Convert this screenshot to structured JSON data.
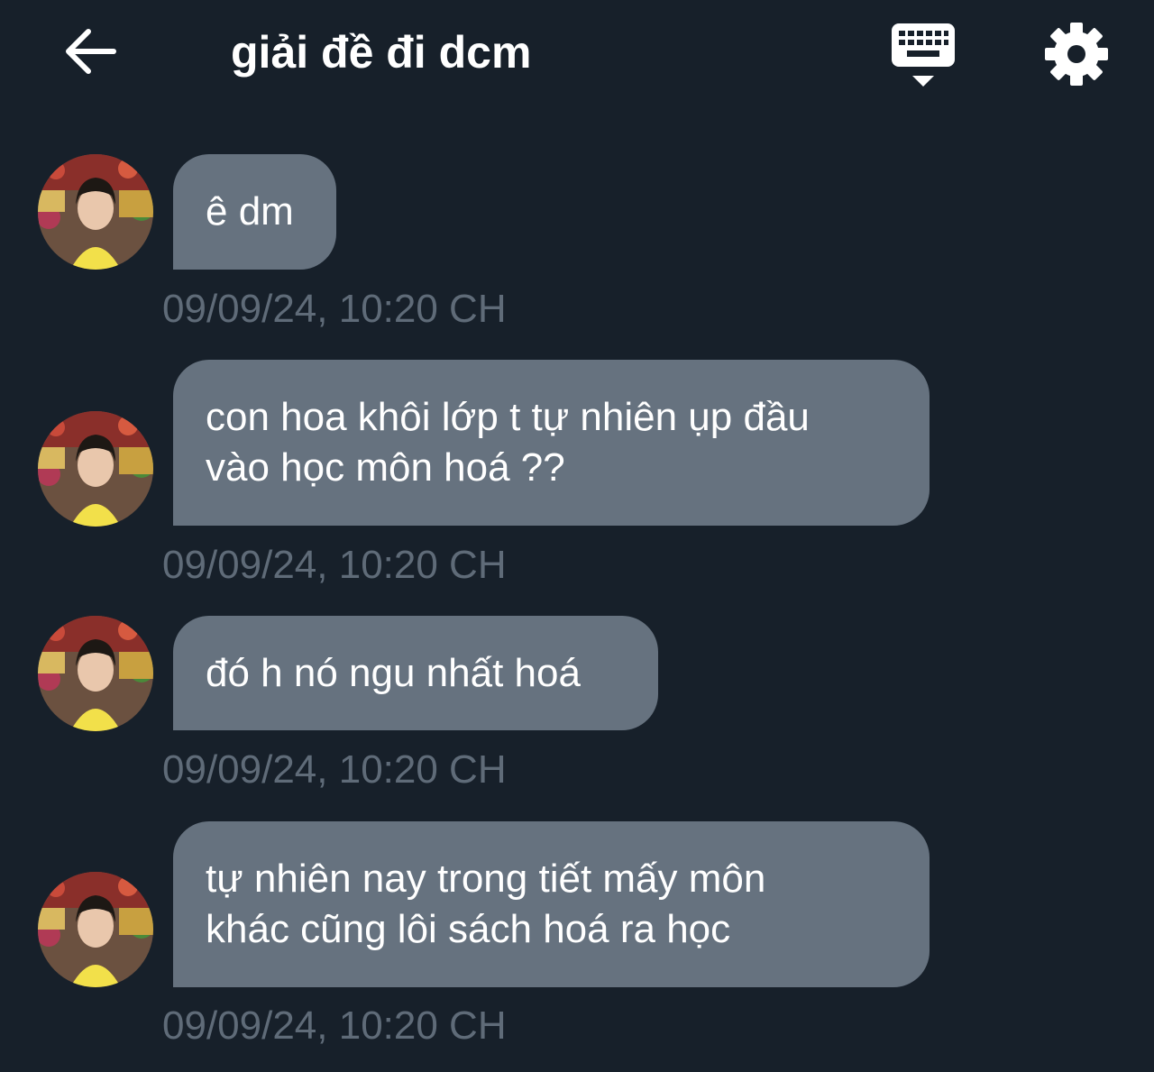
{
  "header": {
    "back_icon": "arrow-left-icon",
    "title": "giải đề đi dcm",
    "keyboard_icon": "keyboard-hide-icon",
    "settings_icon": "gear-icon"
  },
  "messages": [
    {
      "text": "ê dm",
      "timestamp": "09/09/24, 10:20 CH"
    },
    {
      "text": "con hoa khôi lớp t tự nhiên ụp đầu\nvào học môn hoá ??",
      "timestamp": "09/09/24, 10:20 CH"
    },
    {
      "text": "đó h nó ngu nhất hoá",
      "timestamp": "09/09/24, 10:20 CH"
    },
    {
      "text": "tự nhiên nay trong tiết mấy môn\nkhác cũng lôi sách hoá ra học",
      "timestamp": "09/09/24, 10:20 CH"
    }
  ],
  "colors": {
    "background": "#17202a",
    "bubble": "#66727f",
    "timestamp": "#5f6b78",
    "text": "#ffffff"
  }
}
